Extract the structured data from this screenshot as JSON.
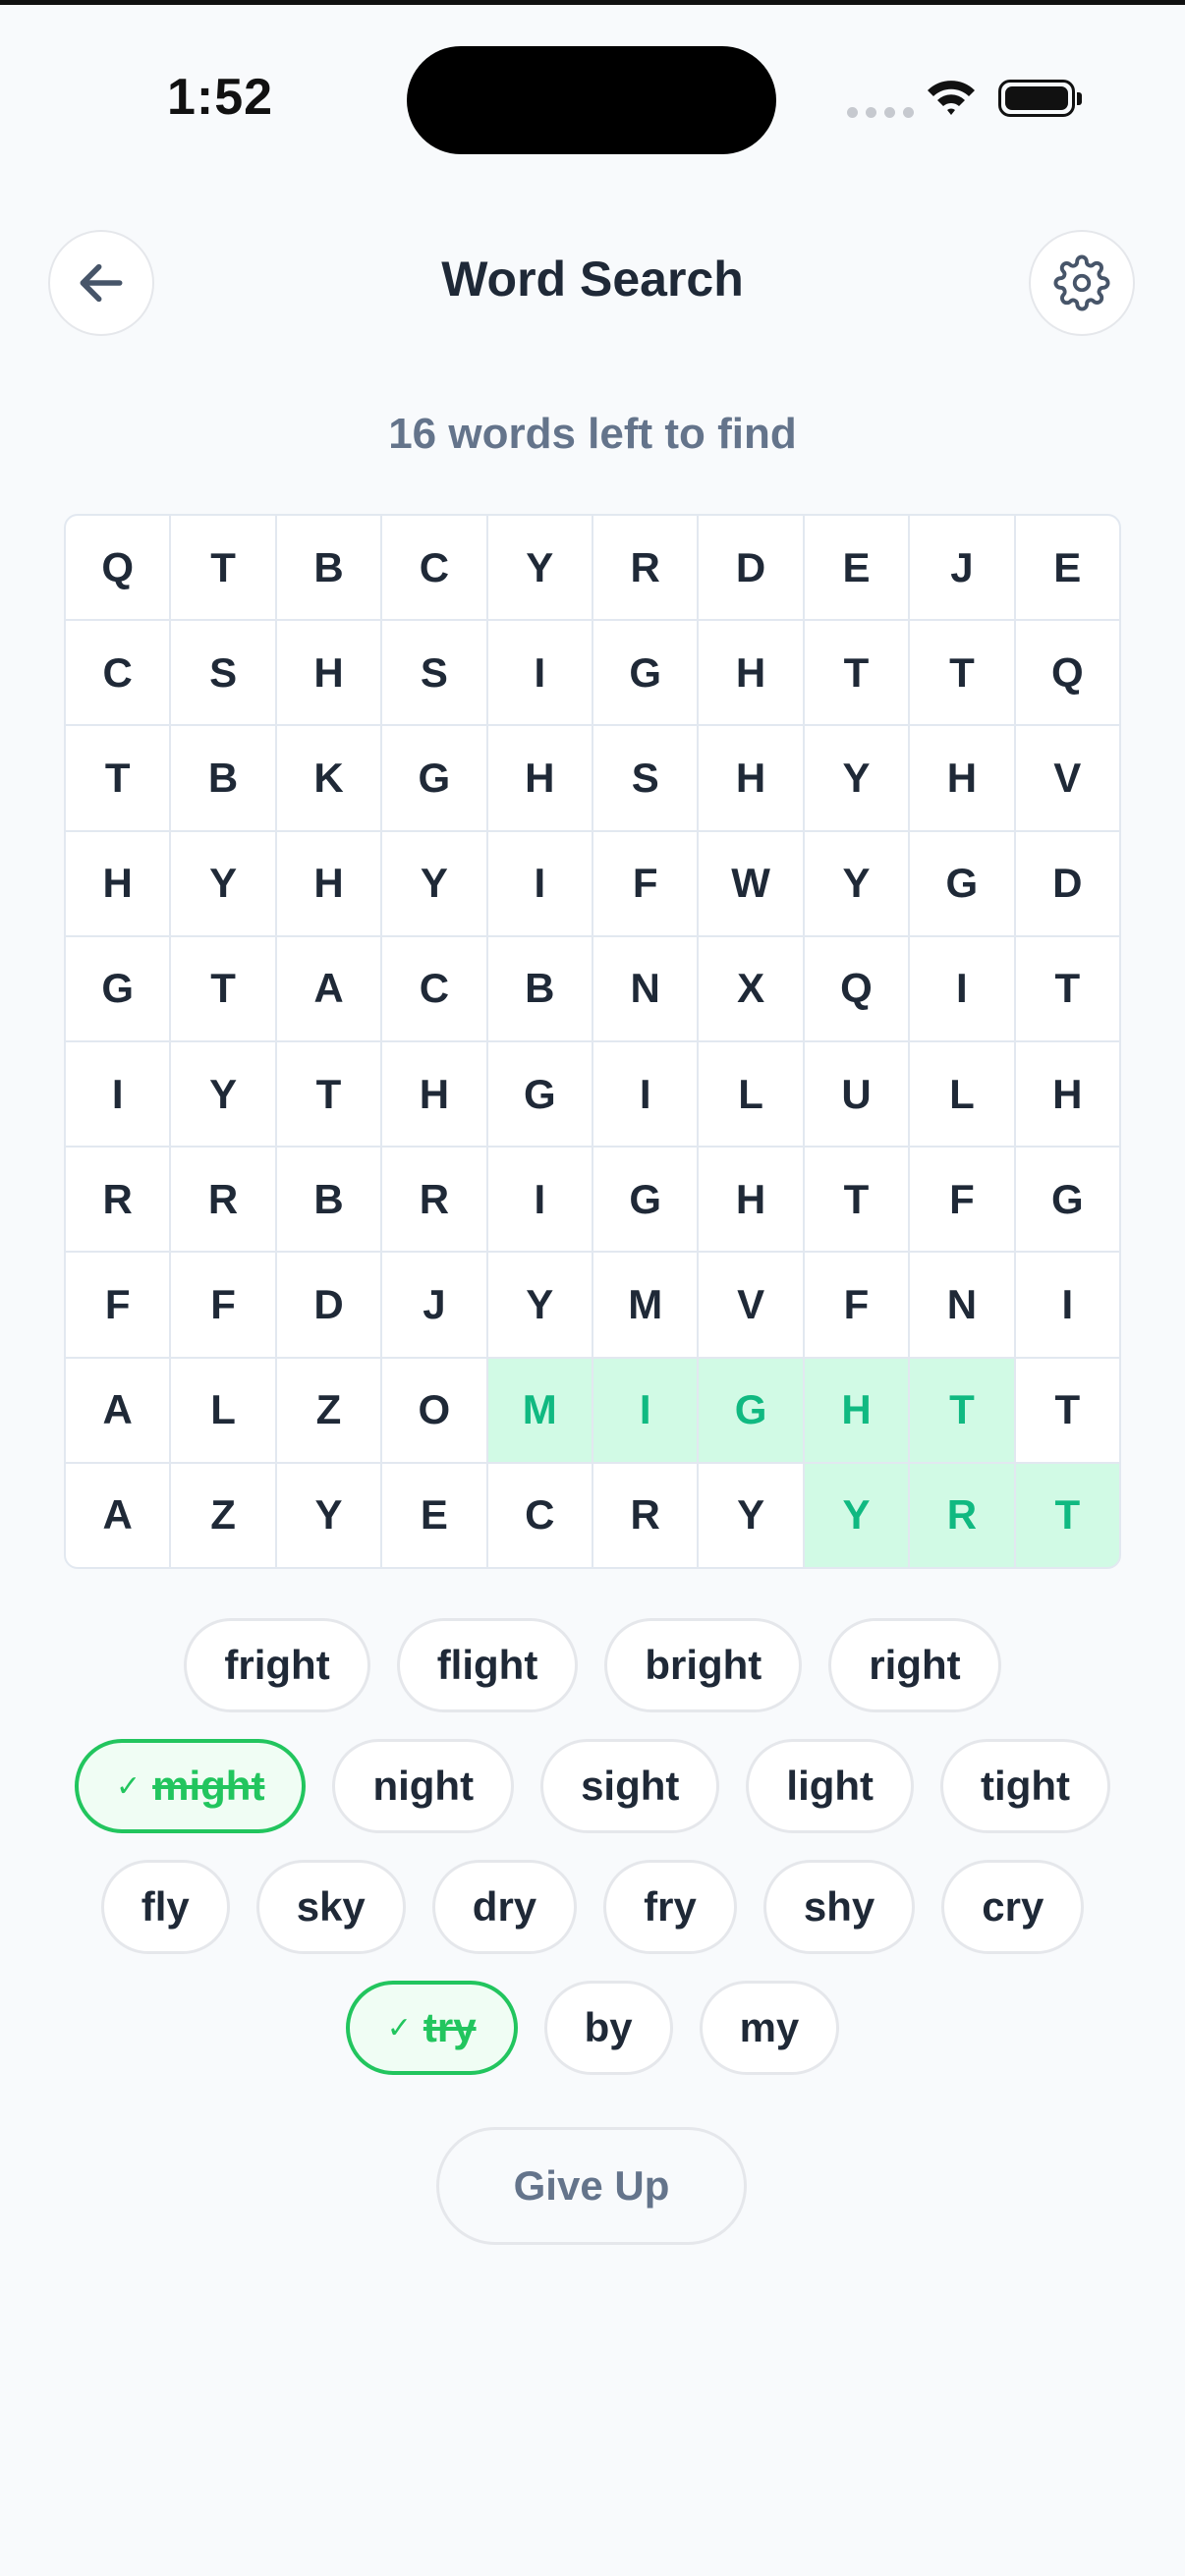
{
  "status_bar": {
    "time": "1:52"
  },
  "header": {
    "title": "Word Search"
  },
  "subtitle": "16 words left to find",
  "grid": {
    "rows": [
      [
        "Q",
        "T",
        "B",
        "C",
        "Y",
        "R",
        "D",
        "E",
        "J",
        "E"
      ],
      [
        "C",
        "S",
        "H",
        "S",
        "I",
        "G",
        "H",
        "T",
        "T",
        "Q"
      ],
      [
        "T",
        "B",
        "K",
        "G",
        "H",
        "S",
        "H",
        "Y",
        "H",
        "V"
      ],
      [
        "H",
        "Y",
        "H",
        "Y",
        "I",
        "F",
        "W",
        "Y",
        "G",
        "D"
      ],
      [
        "G",
        "T",
        "A",
        "C",
        "B",
        "N",
        "X",
        "Q",
        "I",
        "T"
      ],
      [
        "I",
        "Y",
        "T",
        "H",
        "G",
        "I",
        "L",
        "U",
        "L",
        "H"
      ],
      [
        "R",
        "R",
        "B",
        "R",
        "I",
        "G",
        "H",
        "T",
        "F",
        "G"
      ],
      [
        "F",
        "F",
        "D",
        "J",
        "Y",
        "M",
        "V",
        "F",
        "N",
        "I"
      ],
      [
        "A",
        "L",
        "Z",
        "O",
        "M",
        "I",
        "G",
        "H",
        "T",
        "T"
      ],
      [
        "A",
        "Z",
        "Y",
        "E",
        "C",
        "R",
        "Y",
        "Y",
        "R",
        "T"
      ]
    ],
    "found_cells": [
      [
        8,
        4
      ],
      [
        8,
        5
      ],
      [
        8,
        6
      ],
      [
        8,
        7
      ],
      [
        8,
        8
      ],
      [
        9,
        7
      ],
      [
        9,
        8
      ],
      [
        9,
        9
      ]
    ]
  },
  "word_rows": [
    [
      {
        "word": "fright",
        "found": false
      },
      {
        "word": "flight",
        "found": false
      },
      {
        "word": "bright",
        "found": false
      },
      {
        "word": "right",
        "found": false
      }
    ],
    [
      {
        "word": "might",
        "found": true
      },
      {
        "word": "night",
        "found": false
      },
      {
        "word": "sight",
        "found": false
      },
      {
        "word": "light",
        "found": false
      },
      {
        "word": "tight",
        "found": false
      }
    ],
    [
      {
        "word": "fly",
        "found": false
      },
      {
        "word": "sky",
        "found": false
      },
      {
        "word": "dry",
        "found": false
      },
      {
        "word": "fry",
        "found": false
      },
      {
        "word": "shy",
        "found": false
      },
      {
        "word": "cry",
        "found": false
      }
    ],
    [
      {
        "word": "try",
        "found": true
      },
      {
        "word": "by",
        "found": false
      },
      {
        "word": "my",
        "found": false
      }
    ]
  ],
  "check_glyph": "✓",
  "give_up_label": "Give Up",
  "icons": {
    "back": "arrow-left-icon",
    "settings": "gear-icon"
  },
  "colors": {
    "found_text": "#10b981",
    "found_bg": "#d1fae5",
    "found_chip_border": "#22c55e"
  }
}
